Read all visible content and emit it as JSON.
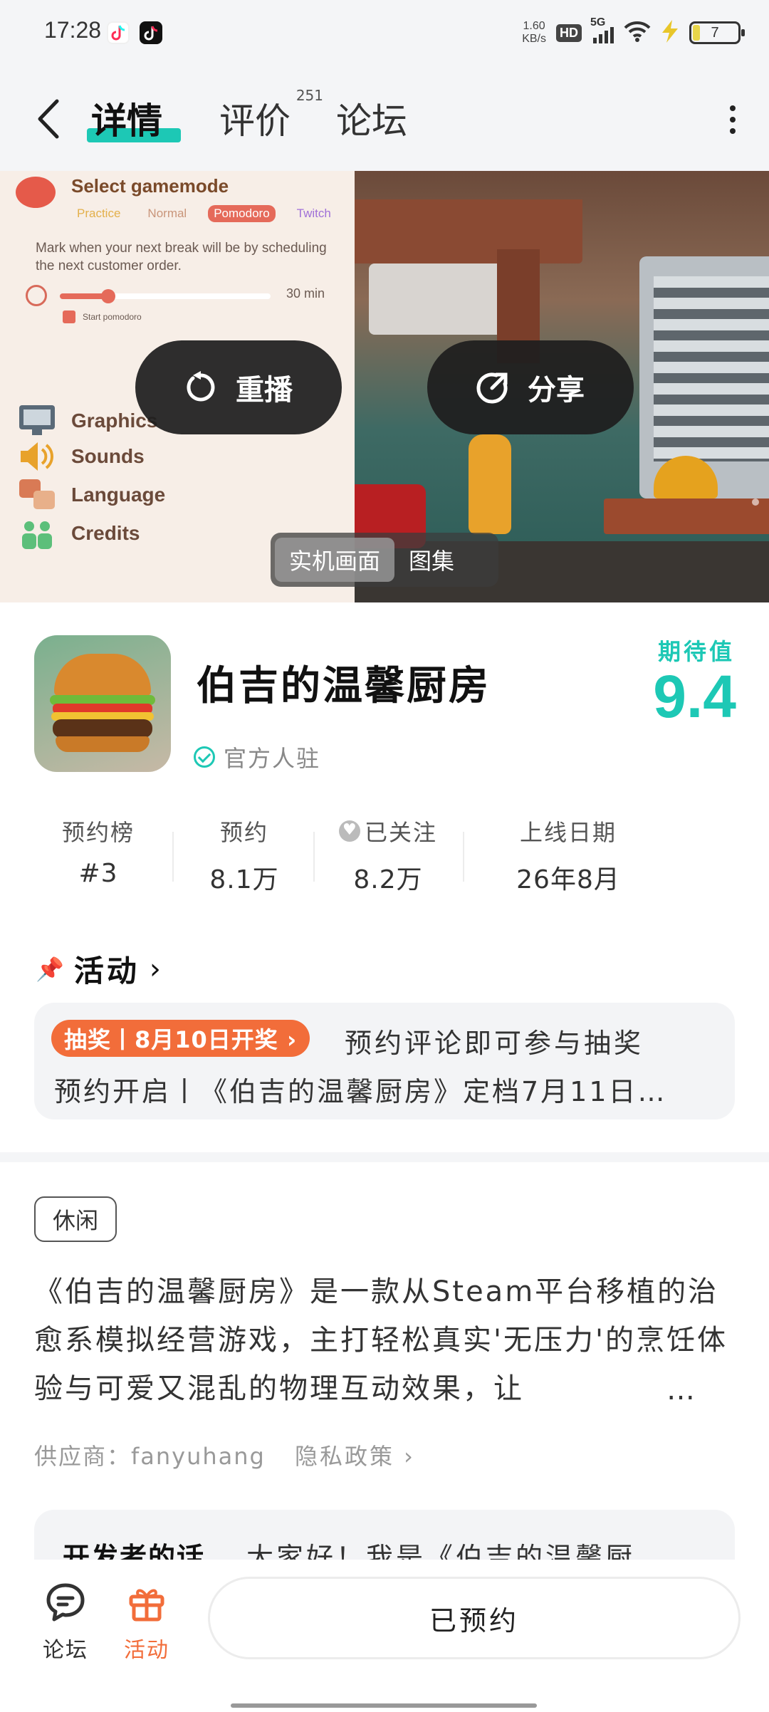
{
  "status_bar": {
    "time": "17:28",
    "net_speed_value": "1.60",
    "net_speed_unit": "KB/s",
    "hd": "HD",
    "network": "5G",
    "battery": "7"
  },
  "topnav": {
    "tabs": [
      {
        "label": "详情",
        "active": true
      },
      {
        "label": "评价",
        "count": "251"
      },
      {
        "label": "论坛"
      }
    ]
  },
  "media": {
    "game_screen": {
      "title": "Select gamemode",
      "modes": [
        "Practice",
        "Normal",
        "Pomodoro",
        "Twitch"
      ],
      "selected_mode": "Pomodoro",
      "description": "Mark when your next break will be by scheduling the next customer order.",
      "slider_value": "30 min",
      "checkbox_label": "Start pomodoro",
      "menu": [
        "Graphics",
        "Sounds",
        "Language",
        "Credits"
      ]
    },
    "replay_label": "重播",
    "share_label": "分享",
    "switch": {
      "items": [
        "实机画面",
        "图集"
      ],
      "active": "实机画面"
    }
  },
  "game": {
    "name": "伯吉的温馨厨房",
    "official": "官方人驻",
    "expectation_label": "期待值",
    "expectation_value": "9.4",
    "accent_color": "#1dc8b5"
  },
  "stats": [
    {
      "label": "预约榜",
      "value": "#3"
    },
    {
      "label": "预约",
      "value": "8.1万"
    },
    {
      "label": "已关注",
      "value": "8.2万",
      "icon": "heart-icon"
    },
    {
      "label": "上线日期",
      "value": "26年8月"
    }
  ],
  "activity": {
    "heading": "活动",
    "tag": "抽奖丨8月10日开奖 ›",
    "line1": "预约评论即可参与抽奖",
    "line2": "预约开启丨《伯吉的温馨厨房》定档7月11日…",
    "tag_color": "#f26d3a"
  },
  "details": {
    "genre": "休闲",
    "description": "《伯吉的温馨厨房》是一款从Steam平台移植的治愈系模拟经营游戏，主打轻松真实'无压力'的烹饪体验与可爱又混乱的物理互动效果，让",
    "ellipsis": "…",
    "supplier": "供应商：fanyuhang",
    "privacy": "隐私政策 ›"
  },
  "developer": {
    "title": "开发者的话",
    "text": "大家好！我是《伯吉的温馨厨"
  },
  "bottom_bar": {
    "forum_label": "论坛",
    "activity_label": "活动",
    "reserve_label": "已预约"
  }
}
